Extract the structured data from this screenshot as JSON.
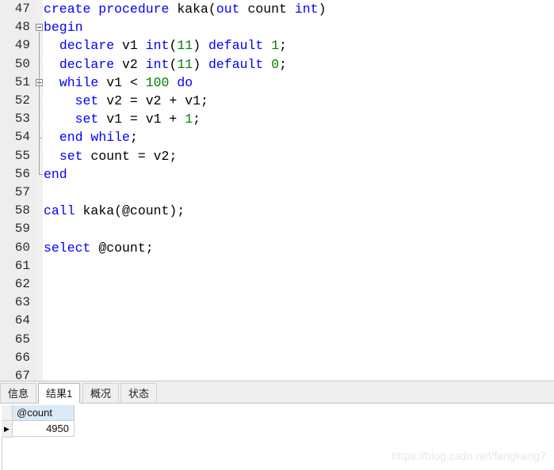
{
  "editor": {
    "first_line_number": 47,
    "lines": [
      {
        "num": "47",
        "tokens": [
          {
            "t": "create procedure ",
            "c": "kw"
          },
          {
            "t": "kaka(",
            "c": "pln"
          },
          {
            "t": "out ",
            "c": "kw"
          },
          {
            "t": "count ",
            "c": "pln"
          },
          {
            "t": "int",
            "c": "kw"
          },
          {
            "t": ")",
            "c": "pln"
          }
        ]
      },
      {
        "num": "48",
        "tokens": [
          {
            "t": "begin",
            "c": "kw"
          }
        ]
      },
      {
        "num": "49",
        "tokens": [
          {
            "t": "  ",
            "c": "pln"
          },
          {
            "t": "declare ",
            "c": "kw"
          },
          {
            "t": "v1 ",
            "c": "pln"
          },
          {
            "t": "int",
            "c": "kw"
          },
          {
            "t": "(",
            "c": "pln"
          },
          {
            "t": "11",
            "c": "num"
          },
          {
            "t": ") ",
            "c": "pln"
          },
          {
            "t": "default ",
            "c": "kw"
          },
          {
            "t": "1",
            "c": "num"
          },
          {
            "t": ";",
            "c": "pln"
          }
        ]
      },
      {
        "num": "50",
        "tokens": [
          {
            "t": "  ",
            "c": "pln"
          },
          {
            "t": "declare ",
            "c": "kw"
          },
          {
            "t": "v2 ",
            "c": "pln"
          },
          {
            "t": "int",
            "c": "kw"
          },
          {
            "t": "(",
            "c": "pln"
          },
          {
            "t": "11",
            "c": "num"
          },
          {
            "t": ") ",
            "c": "pln"
          },
          {
            "t": "default ",
            "c": "kw"
          },
          {
            "t": "0",
            "c": "num"
          },
          {
            "t": ";",
            "c": "pln"
          }
        ]
      },
      {
        "num": "51",
        "tokens": [
          {
            "t": "  ",
            "c": "pln"
          },
          {
            "t": "while ",
            "c": "kw"
          },
          {
            "t": "v1 < ",
            "c": "pln"
          },
          {
            "t": "100",
            "c": "num"
          },
          {
            "t": " ",
            "c": "pln"
          },
          {
            "t": "do",
            "c": "kw"
          }
        ]
      },
      {
        "num": "52",
        "tokens": [
          {
            "t": "    ",
            "c": "pln"
          },
          {
            "t": "set ",
            "c": "kw"
          },
          {
            "t": "v2 = v2 + v1;",
            "c": "pln"
          }
        ]
      },
      {
        "num": "53",
        "tokens": [
          {
            "t": "    ",
            "c": "pln"
          },
          {
            "t": "set ",
            "c": "kw"
          },
          {
            "t": "v1 = v1 + ",
            "c": "pln"
          },
          {
            "t": "1",
            "c": "num"
          },
          {
            "t": ";",
            "c": "pln"
          }
        ]
      },
      {
        "num": "54",
        "tokens": [
          {
            "t": "  ",
            "c": "pln"
          },
          {
            "t": "end while",
            "c": "kw"
          },
          {
            "t": ";",
            "c": "pln"
          }
        ]
      },
      {
        "num": "55",
        "tokens": [
          {
            "t": "  ",
            "c": "pln"
          },
          {
            "t": "set ",
            "c": "kw"
          },
          {
            "t": "count = v2;",
            "c": "pln"
          }
        ]
      },
      {
        "num": "56",
        "tokens": [
          {
            "t": "end",
            "c": "kw"
          }
        ]
      },
      {
        "num": "57",
        "tokens": []
      },
      {
        "num": "58",
        "tokens": [
          {
            "t": "call ",
            "c": "kw"
          },
          {
            "t": "kaka(@count);",
            "c": "pln"
          }
        ]
      },
      {
        "num": "59",
        "tokens": []
      },
      {
        "num": "60",
        "tokens": [
          {
            "t": "select ",
            "c": "kw"
          },
          {
            "t": "@count;",
            "c": "pln"
          }
        ]
      },
      {
        "num": "61",
        "tokens": []
      },
      {
        "num": "62",
        "tokens": []
      },
      {
        "num": "63",
        "tokens": []
      },
      {
        "num": "64",
        "tokens": []
      },
      {
        "num": "65",
        "tokens": []
      },
      {
        "num": "66",
        "tokens": []
      },
      {
        "num": "67",
        "tokens": []
      }
    ],
    "fold_markers": [
      {
        "type": "box",
        "line_index": 1
      },
      {
        "type": "box",
        "line_index": 4
      },
      {
        "type": "tick",
        "line_index": 7
      },
      {
        "type": "end",
        "line_index": 9
      }
    ],
    "colors": {
      "keyword": "#0000ff",
      "number": "#008000",
      "plain": "#000000",
      "gutter_bg": "#eeeeee",
      "editor_bg": "#ffffff"
    }
  },
  "tabs": [
    {
      "label": "信息",
      "active": false
    },
    {
      "label": "结果1",
      "active": true
    },
    {
      "label": "概况",
      "active": false
    },
    {
      "label": "状态",
      "active": false
    }
  ],
  "result_grid": {
    "columns": [
      "@count"
    ],
    "rows": [
      {
        "selected": true,
        "cells": [
          "4950"
        ]
      }
    ],
    "row_indicator_glyph": "▶",
    "header_bg": "#dbeaf7"
  },
  "watermark": {
    "text": "https://blog.csdn.net/fangkang7"
  }
}
